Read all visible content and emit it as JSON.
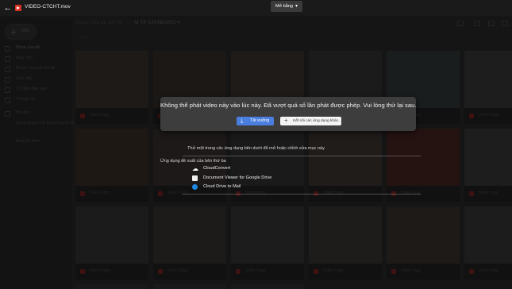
{
  "topbar": {
    "file_name": "VIDEO-CTCHT.mov",
    "open_with_label": "Mở bằng"
  },
  "drive": {
    "new_label": "Mới",
    "sidebar": [
      {
        "label": "Drive của tôi"
      },
      {
        "label": "Máy tính"
      },
      {
        "label": "Được chia sẻ với tôi"
      },
      {
        "label": "Gần đây"
      },
      {
        "label": "Có gắn dấu sao"
      },
      {
        "label": "Thùng rác"
      },
      {
        "label": "Bộ nhớ"
      },
      {
        "label": "Đã sử dụng 0 GB trong tổng số 15 GB"
      },
      {
        "label": "Mua bộ nhớ"
      }
    ],
    "breadcrumb": [
      "Được chia sẻ với tôi",
      "›",
      "M TP STANDARD ▾"
    ],
    "section_name": "Tệp",
    "tile_caption": "Video 0.jpg"
  },
  "dialog": {
    "message": "Không thể phát video này vào lúc này. Đã vượt quá số lần phát được phép. Vui lòng thử lại sau.",
    "download_label": "Tải xuống",
    "connect_label": "Kết nối các ứng dụng khác..."
  },
  "apps": {
    "prompt": "Thử một trong các ứng dụng bên dưới để mở hoặc chỉnh sửa mục này",
    "suggested_heading": "Ứng dụng đề xuất của bên thứ ba",
    "items": [
      {
        "name": "CloudConvert",
        "icon": "cloud-icon"
      },
      {
        "name": "Document Viewer for Google Drive",
        "icon": "document-icon"
      },
      {
        "name": "Cloud Drive to Mail",
        "icon": "mail-icon"
      }
    ]
  },
  "colors": {
    "accent_blue": "#4a7fe0",
    "video_red": "#d93025",
    "dialog_bg": "#3d3d3d"
  }
}
